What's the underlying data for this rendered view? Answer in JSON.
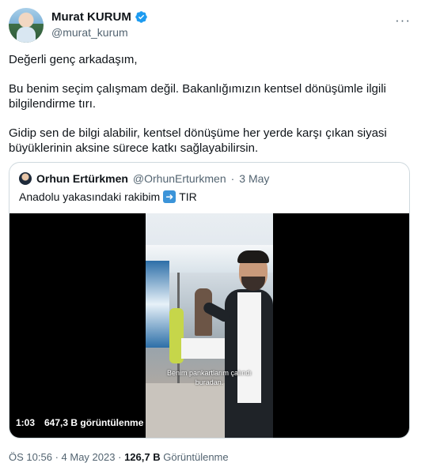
{
  "author": {
    "name": "Murat KURUM",
    "handle": "@murat_kurum",
    "verified": true,
    "verified_icon": "verified-badge-icon",
    "verified_color": "#1d9bf0"
  },
  "more_label": "···",
  "tweet": {
    "paragraphs": [
      "Değerli genç arkadaşım,",
      "Bu benim seçim çalışmam değil. Bakanlığımızın kentsel dönüşümle ilgili bilgilendirme tırı.",
      "Gidip sen de bilgi alabilir, kentsel dönüşüme her yerde karşı çıkan siyasi büyüklerinin aksine sürece katkı sağlayabilirsin."
    ]
  },
  "quoted": {
    "name": "Orhun Ertürkmen",
    "handle": "@OrhunErturkmen",
    "separator": "·",
    "date": "3 May",
    "text_before": "Anadolu yakasındaki rakibim",
    "emoji": "right-arrow-emoji",
    "text_after": "TIR",
    "video": {
      "subtitle_line1": "Benim pankartlarım çalındı",
      "subtitle_line2": "buradan.",
      "duration": "1:03",
      "views": "647,3 B görüntülenme"
    }
  },
  "footer": {
    "time": "ÖS 10:56",
    "separator": "·",
    "date": "4 May 2023",
    "views_count": "126,7 B",
    "views_label": "Görüntülenme"
  }
}
